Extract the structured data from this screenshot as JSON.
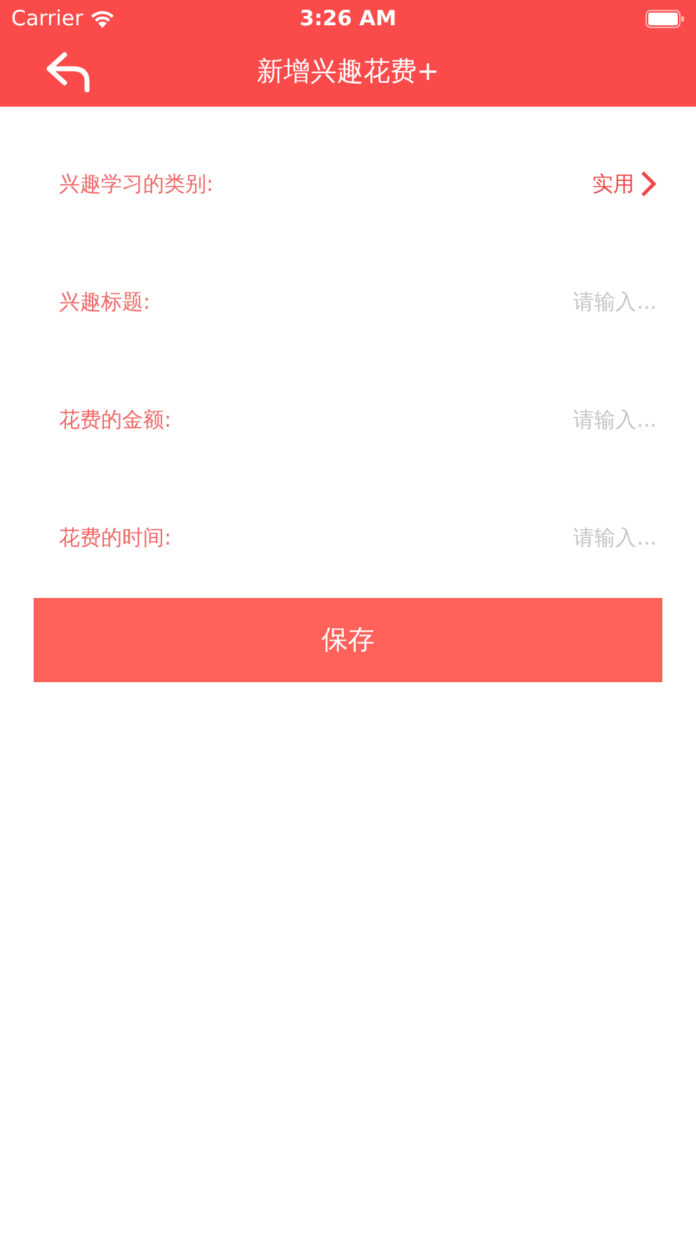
{
  "status_bar": {
    "carrier": "Carrier",
    "time": "3:26 AM"
  },
  "nav": {
    "title": "新增兴趣花费+"
  },
  "fields": [
    {
      "kind": "select",
      "label": "兴趣学习的类别:",
      "value": "实用"
    },
    {
      "kind": "input",
      "label": "兴趣标题:",
      "placeholder": "请输入..."
    },
    {
      "kind": "input",
      "label": "花费的金额:",
      "placeholder": "请输入..."
    },
    {
      "kind": "input",
      "label": "花费的时间:",
      "placeholder": "请输入..."
    }
  ],
  "save_button": {
    "label": "保存"
  }
}
